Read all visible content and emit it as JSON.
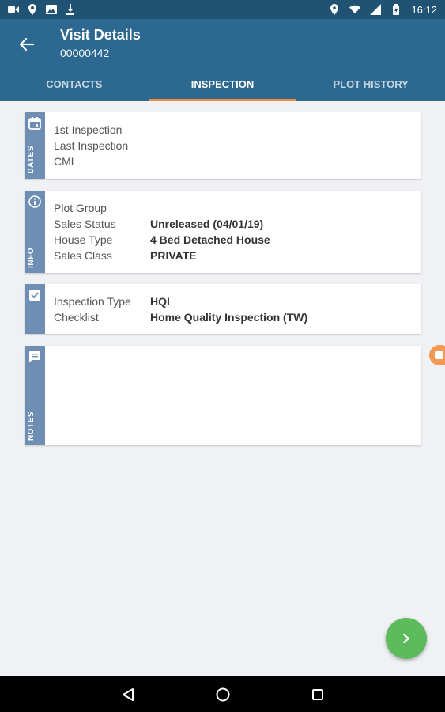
{
  "status_bar": {
    "time": "16:12",
    "icons": [
      "video-icon",
      "location-pin-icon",
      "image-icon",
      "download-icon",
      "location-icon",
      "wifi-icon",
      "signal-icon",
      "battery-icon"
    ]
  },
  "header": {
    "title": "Visit Details",
    "subtitle": "00000442"
  },
  "tabs": [
    {
      "label": "CONTACTS",
      "active": false
    },
    {
      "label": "INSPECTION",
      "active": true
    },
    {
      "label": "PLOT HISTORY",
      "active": false
    }
  ],
  "cards": {
    "dates": {
      "rail_label": "DATES",
      "rows": [
        {
          "label": "1st Inspection",
          "value": ""
        },
        {
          "label": "Last Inspection",
          "value": ""
        },
        {
          "label": "CML",
          "value": ""
        }
      ]
    },
    "info": {
      "rail_label": "INFO",
      "rows": [
        {
          "label": "Plot Group",
          "value": ""
        },
        {
          "label": "Sales Status",
          "value": "Unreleased (04/01/19)"
        },
        {
          "label": "House Type",
          "value": "4 Bed Detached House"
        },
        {
          "label": "Sales Class",
          "value": "PRIVATE"
        }
      ]
    },
    "inspection": {
      "rows": [
        {
          "label": "Inspection Type",
          "value": "HQI"
        },
        {
          "label": "Checklist",
          "value": "Home Quality Inspection (TW)"
        }
      ]
    },
    "notes": {
      "rail_label": "NOTES"
    }
  },
  "colors": {
    "status_bar": "#1f5273",
    "app_bar": "#2c6890",
    "tab_indicator": "#f08a3b",
    "card_rail": "#6e8fb3",
    "fab": "#5cbc5b"
  }
}
